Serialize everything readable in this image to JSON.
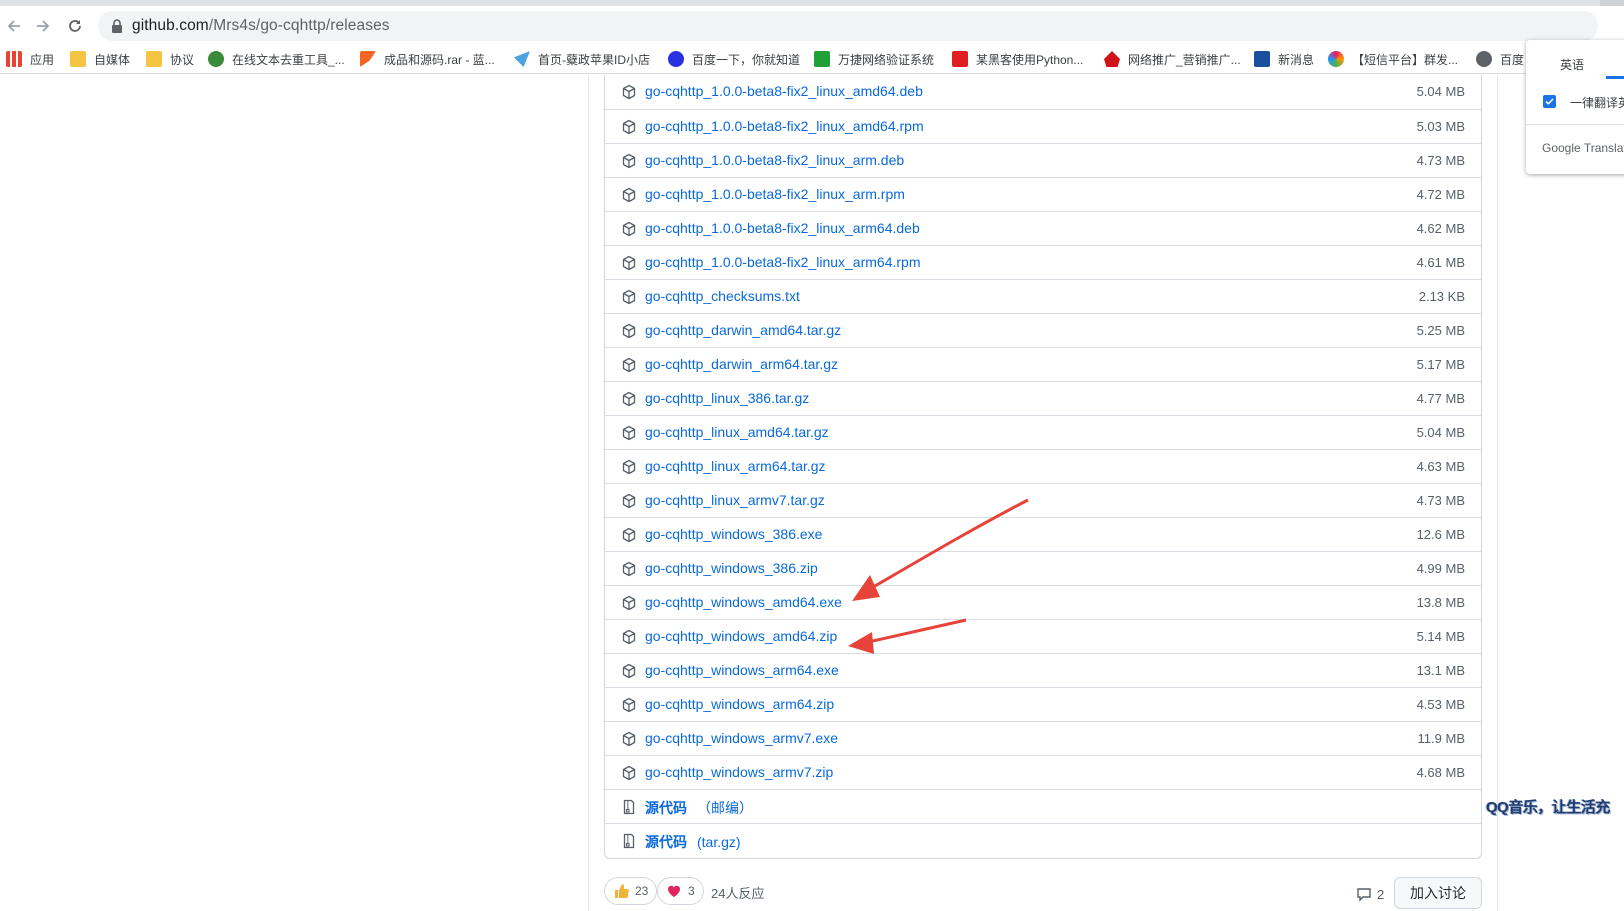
{
  "browser": {
    "url_domain": "github.com",
    "url_path": "/Mrs4s/go-cqhttp/releases"
  },
  "bookmarks": [
    {
      "label": "应用",
      "icon": "apps-grid-icon"
    },
    {
      "label": "自媒体",
      "icon": "folder-icon"
    },
    {
      "label": "协议",
      "icon": "folder-icon"
    },
    {
      "label": "在线文本去重工具_...",
      "icon": "frog-icon"
    },
    {
      "label": "成品和源码.rar - 蓝...",
      "icon": "flag-icon"
    },
    {
      "label": "首页-糵政苹果ID小店",
      "icon": "bird-icon"
    },
    {
      "label": "百度一下，你就知道",
      "icon": "baidu-paw-icon"
    },
    {
      "label": "万捷网络验证系统",
      "icon": "w-logo-icon"
    },
    {
      "label": "某黑客使用Python...",
      "icon": "red-badge-icon"
    },
    {
      "label": "网络推广_营销推广...",
      "icon": "red-house-icon"
    },
    {
      "label": "新消息",
      "icon": "u-logo-icon"
    },
    {
      "label": "【短信平台】群发...",
      "icon": "ring-logo-icon"
    },
    {
      "label": "百度",
      "icon": "globe-icon"
    }
  ],
  "translate_popup": {
    "language": "英语",
    "always_translate": "一律翻译英",
    "brand": "Google Translat"
  },
  "assets": [
    {
      "name": "go-cqhttp_1.0.0-beta8-fix2_linux_amd64.deb",
      "size": "5.04 MB"
    },
    {
      "name": "go-cqhttp_1.0.0-beta8-fix2_linux_amd64.rpm",
      "size": "5.03 MB"
    },
    {
      "name": "go-cqhttp_1.0.0-beta8-fix2_linux_arm.deb",
      "size": "4.73 MB"
    },
    {
      "name": "go-cqhttp_1.0.0-beta8-fix2_linux_arm.rpm",
      "size": "4.72 MB"
    },
    {
      "name": "go-cqhttp_1.0.0-beta8-fix2_linux_arm64.deb",
      "size": "4.62 MB"
    },
    {
      "name": "go-cqhttp_1.0.0-beta8-fix2_linux_arm64.rpm",
      "size": "4.61 MB"
    },
    {
      "name": "go-cqhttp_checksums.txt",
      "size": "2.13 KB"
    },
    {
      "name": "go-cqhttp_darwin_amd64.tar.gz",
      "size": "5.25 MB"
    },
    {
      "name": "go-cqhttp_darwin_arm64.tar.gz",
      "size": "5.17 MB"
    },
    {
      "name": "go-cqhttp_linux_386.tar.gz",
      "size": "4.77 MB"
    },
    {
      "name": "go-cqhttp_linux_amd64.tar.gz",
      "size": "5.04 MB"
    },
    {
      "name": "go-cqhttp_linux_arm64.tar.gz",
      "size": "4.63 MB"
    },
    {
      "name": "go-cqhttp_linux_armv7.tar.gz",
      "size": "4.73 MB"
    },
    {
      "name": "go-cqhttp_windows_386.exe",
      "size": "12.6 MB"
    },
    {
      "name": "go-cqhttp_windows_386.zip",
      "size": "4.99 MB"
    },
    {
      "name": "go-cqhttp_windows_amd64.exe",
      "size": "13.8 MB"
    },
    {
      "name": "go-cqhttp_windows_amd64.zip",
      "size": "5.14 MB"
    },
    {
      "name": "go-cqhttp_windows_arm64.exe",
      "size": "13.1 MB"
    },
    {
      "name": "go-cqhttp_windows_arm64.zip",
      "size": "4.53 MB"
    },
    {
      "name": "go-cqhttp_windows_armv7.exe",
      "size": "11.9 MB"
    },
    {
      "name": "go-cqhttp_windows_armv7.zip",
      "size": "4.68 MB"
    }
  ],
  "source_code": [
    {
      "label": "源代码",
      "suffix": "（邮编）"
    },
    {
      "label": "源代码",
      "suffix": "(tar.gz)"
    }
  ],
  "reactions": {
    "thumbs_up_count": "23",
    "heart_count": "3",
    "summary": "24人反应"
  },
  "comments_count": "2",
  "join_discussion_label": "加入讨论",
  "overlay_text": "QQ音乐，让生活充",
  "colors": {
    "link": "#0969da",
    "arrow": "#e8433a"
  }
}
